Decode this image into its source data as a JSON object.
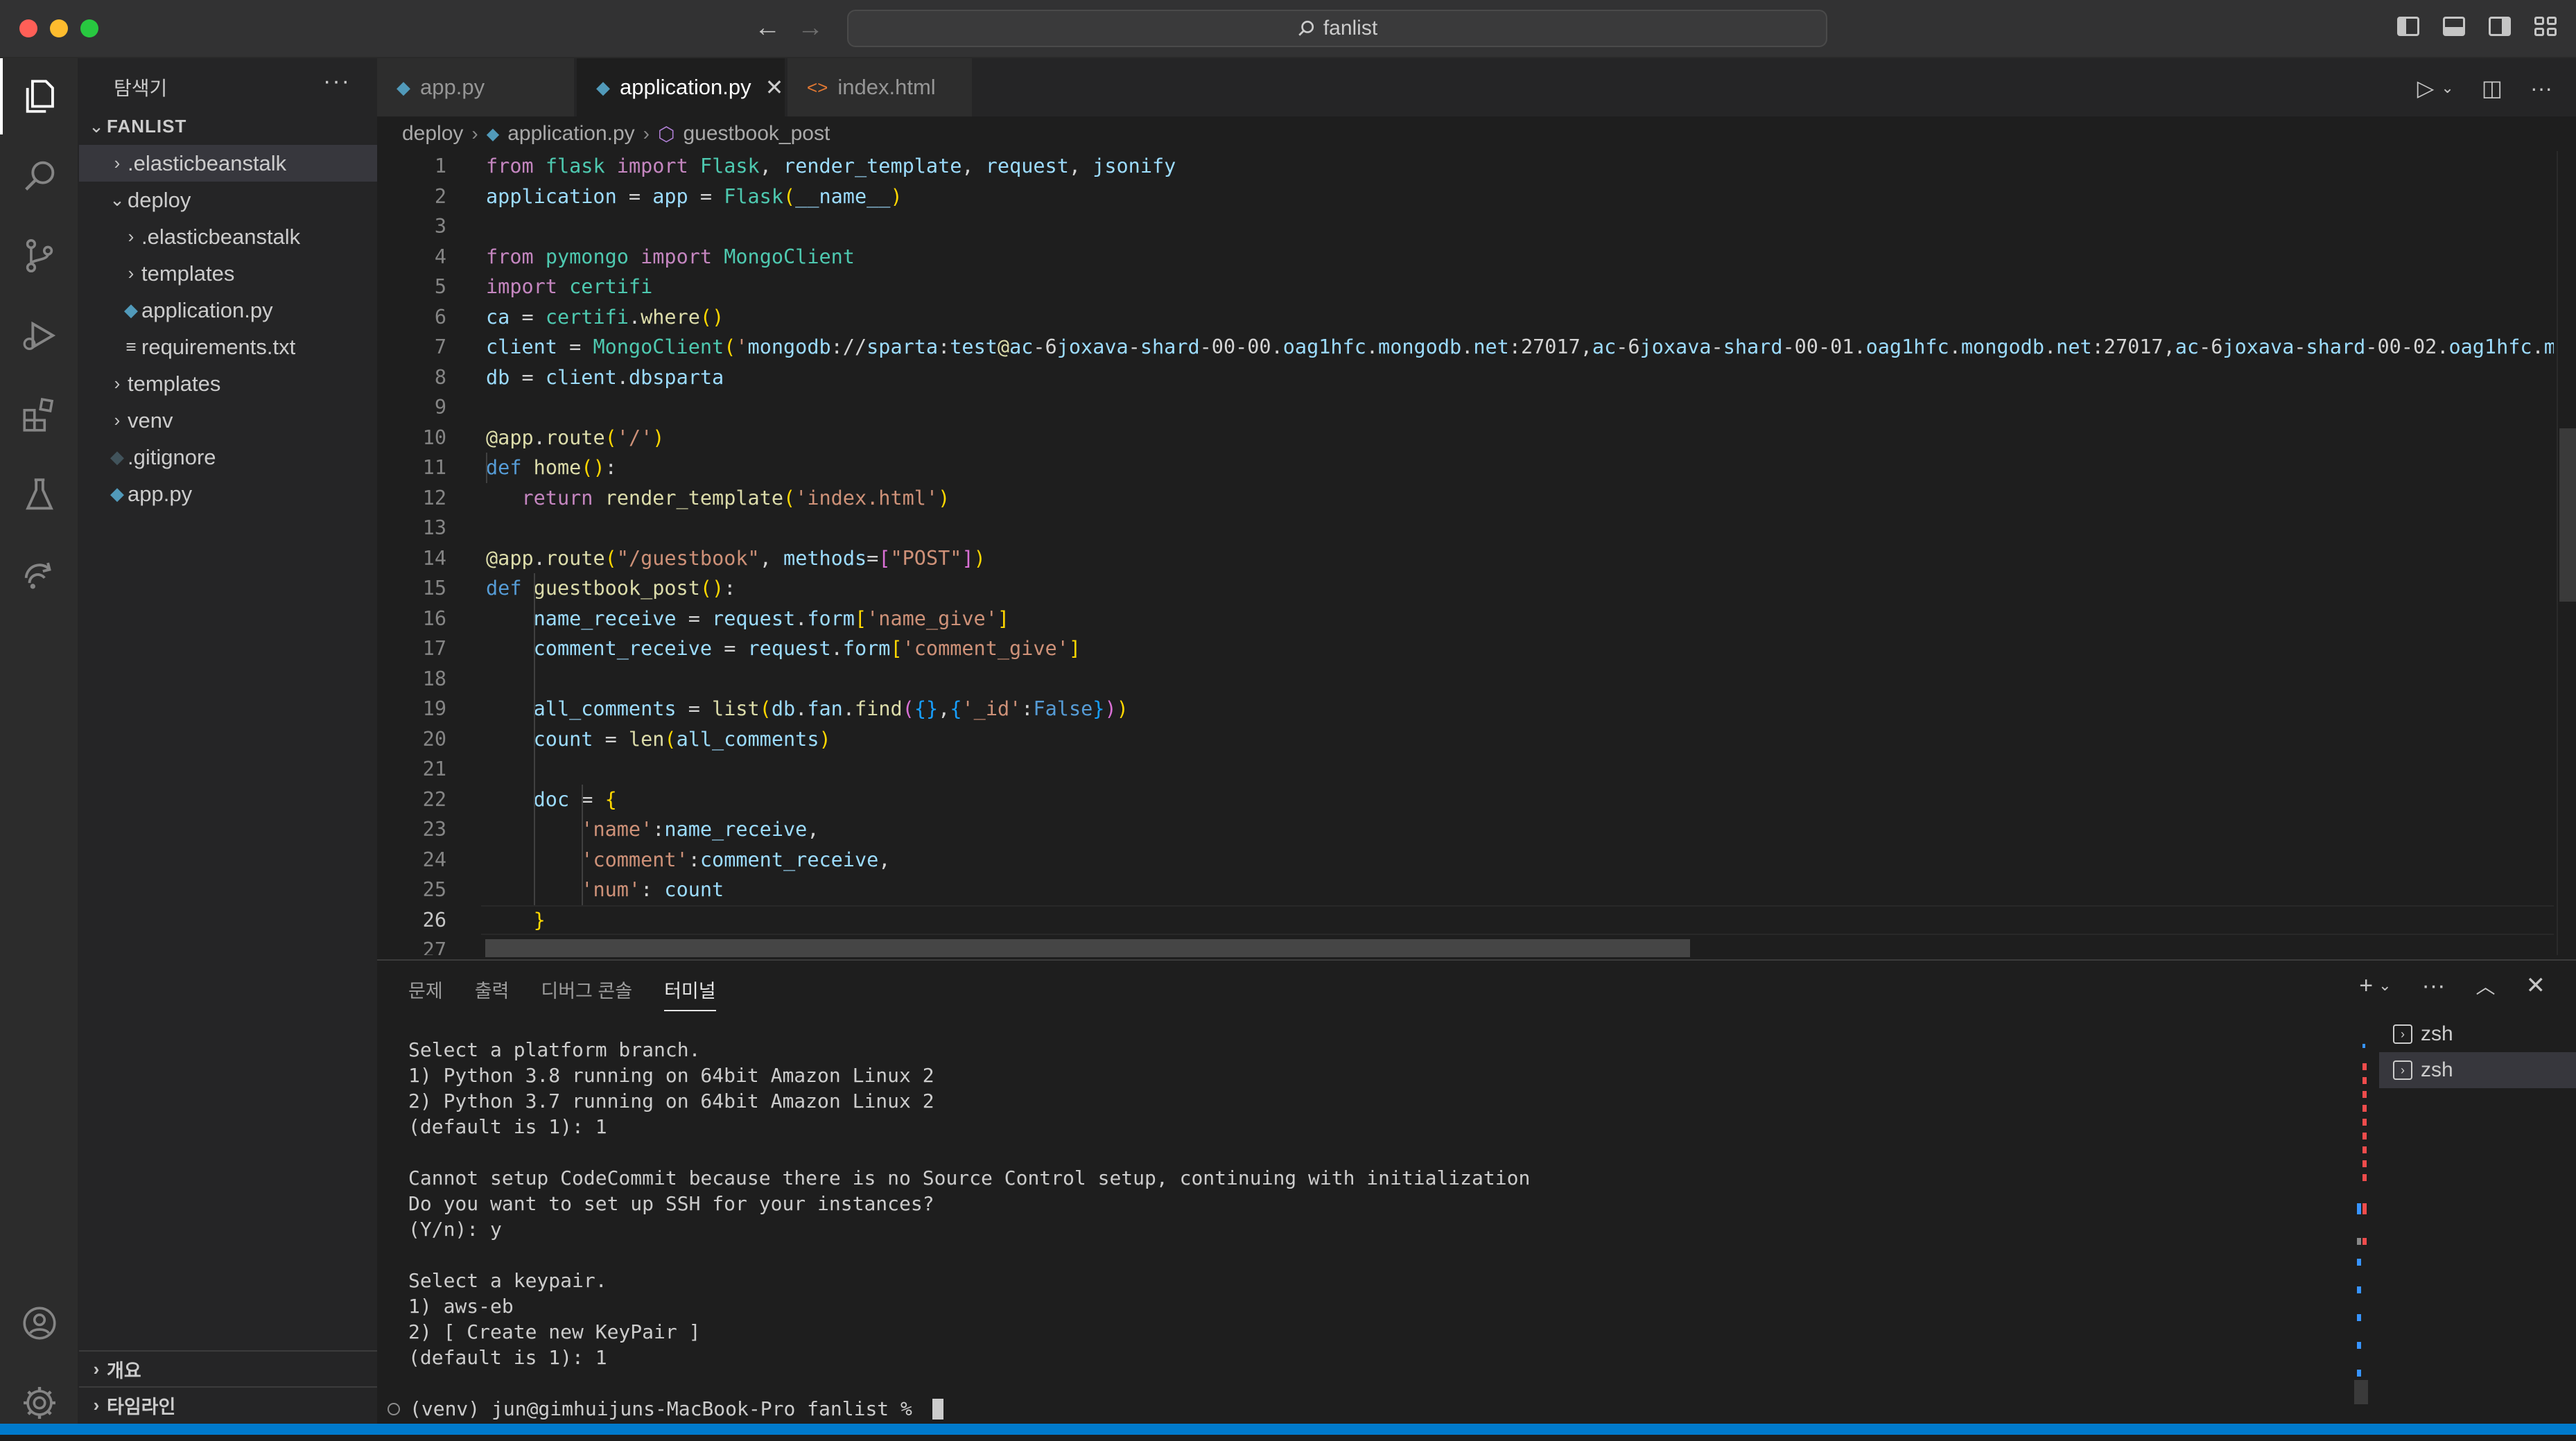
{
  "window": {
    "search_text": "fanlist"
  },
  "sidebar": {
    "title": "탐색기",
    "root": "FANLIST",
    "items": [
      {
        "label": ".elasticbeanstalk",
        "kind": "folder",
        "depth": 1,
        "expanded": false,
        "selected": true
      },
      {
        "label": "deploy",
        "kind": "folder",
        "depth": 1,
        "expanded": true
      },
      {
        "label": ".elasticbeanstalk",
        "kind": "folder",
        "depth": 2,
        "expanded": false
      },
      {
        "label": "templates",
        "kind": "folder",
        "depth": 2,
        "expanded": false
      },
      {
        "label": "application.py",
        "kind": "python",
        "depth": 2
      },
      {
        "label": "requirements.txt",
        "kind": "text",
        "depth": 2
      },
      {
        "label": "templates",
        "kind": "folder",
        "depth": 1,
        "expanded": false
      },
      {
        "label": "venv",
        "kind": "folder",
        "depth": 1,
        "expanded": false
      },
      {
        "label": ".gitignore",
        "kind": "git",
        "depth": 1
      },
      {
        "label": "app.py",
        "kind": "python",
        "depth": 1
      }
    ],
    "outline_label": "개요",
    "timeline_label": "타임라인"
  },
  "tabs": [
    {
      "label": "app.py",
      "icon": "python-icon",
      "active": false
    },
    {
      "label": "application.py",
      "icon": "python-icon",
      "active": true
    },
    {
      "label": "index.html",
      "icon": "html-icon",
      "active": false
    }
  ],
  "breadcrumb": {
    "folder": "deploy",
    "file": "application.py",
    "symbol": "guestbook_post"
  },
  "editor": {
    "current_line": 26,
    "line_numbers": [
      "1",
      "2",
      "3",
      "4",
      "5",
      "6",
      "7",
      "8",
      "9",
      "10",
      "11",
      "12",
      "13",
      "14",
      "15",
      "16",
      "17",
      "18",
      "19",
      "20",
      "21",
      "22",
      "23",
      "24",
      "25",
      "26",
      "27"
    ],
    "lines": [
      "from flask import Flask, render_template, request, jsonify",
      "application = app = Flask(__name__)",
      "",
      "from pymongo import MongoClient",
      "import certifi",
      "ca = certifi.where()",
      "client = MongoClient('mongodb://sparta:test@ac-6joxava-shard-00-00.oag1hfc.mongodb.net:27017,ac-6joxava-shard-00-01.oag1hfc.mongodb.net:27017,ac-6joxava-shard-00-02.oag1hfc.m",
      "db = client.dbsparta",
      "",
      "@app.route('/')",
      "def home():",
      "   return render_template('index.html')",
      "",
      "@app.route(\"/guestbook\", methods=[\"POST\"])",
      "def guestbook_post():",
      "    name_receive = request.form['name_give']",
      "    comment_receive = request.form['comment_give']",
      "",
      "    all_comments = list(db.fan.find({},{'_id':False}))",
      "    count = len(all_comments)",
      "",
      "    doc = {",
      "        'name':name_receive,",
      "        'comment':comment_receive,",
      "        'num': count",
      "    }",
      ""
    ]
  },
  "panel": {
    "tabs": [
      "문제",
      "출력",
      "디버그 콘솔",
      "터미널"
    ],
    "active_tab": "터미널",
    "terminal_output": "Select a platform branch.\n1) Python 3.8 running on 64bit Amazon Linux 2\n2) Python 3.7 running on 64bit Amazon Linux 2\n(default is 1): 1\n\nCannot setup CodeCommit because there is no Source Control setup, continuing with initialization\nDo you want to set up SSH for your instances?\n(Y/n): y\n\nSelect a keypair.\n1) aws-eb\n2) [ Create new KeyPair ]\n(default is 1): 1",
    "prompt": "(venv) jun@gimhuijuns-MacBook-Pro fanlist % ",
    "terminals": [
      "zsh",
      "zsh"
    ]
  },
  "colors": {
    "accent": "#007acc",
    "keyword": "#c586c0",
    "string": "#ce9178",
    "function": "#dcdcaa",
    "class": "#4ec9b0"
  }
}
